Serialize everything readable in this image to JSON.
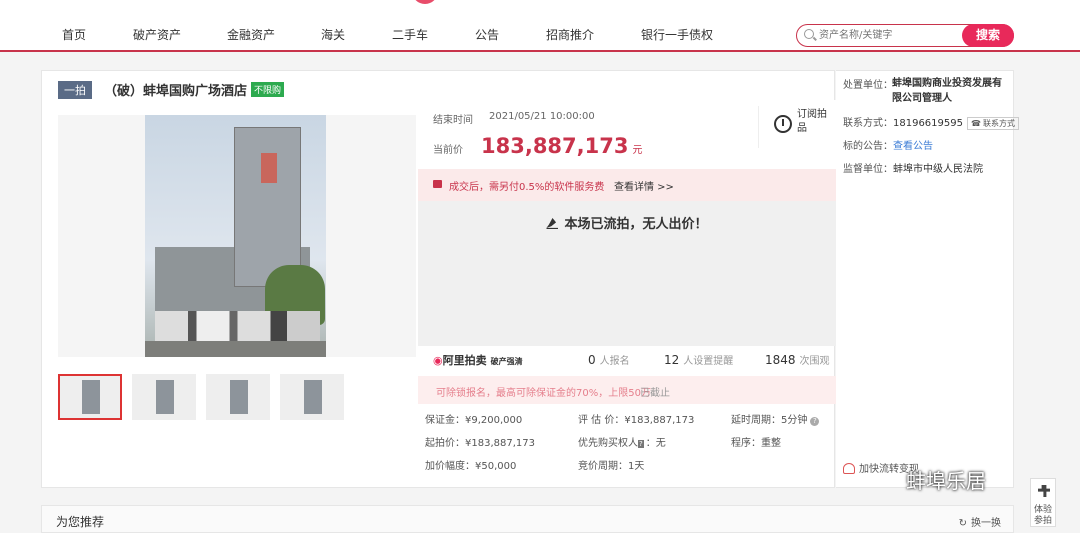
{
  "nav": {
    "items": [
      "首页",
      "破产资产",
      "金融资产",
      "海关",
      "二手车",
      "公告",
      "招商推介",
      "银行一手债权"
    ]
  },
  "search": {
    "placeholder": "资产名称/关键字",
    "button": "搜索"
  },
  "listing": {
    "round_tag": "一拍",
    "title": "（破）蚌埠国购广场酒店",
    "no_limit_tag": "不限购"
  },
  "auction": {
    "end_label": "结束时间",
    "end_value": "2021/05/21 10:00:00",
    "price_label": "当前价",
    "price_value": "183,887,173",
    "price_unit": "元",
    "subscribe_label": "订阅拍品",
    "notice_text": "成交后，需另付0.5%的软件服务费",
    "notice_link": "查看详情 >>",
    "result_text": "本场已流拍，无人出价！"
  },
  "stats": {
    "brand": "阿里拍卖",
    "brand_sub": "破产强清",
    "signup_count": "0",
    "signup_label": "人报名",
    "reminder_count": "12",
    "reminder_label": "人设置提醒",
    "views_count": "1848",
    "views_label": "次围观"
  },
  "deposit_bar": {
    "text": "可除锁报名，最高可除保证金的70%，上限50万",
    "status": "已截止"
  },
  "params": {
    "deposit": "保证金：¥9,200,000",
    "appraisal": "评 估 价：¥183,887,173",
    "delay": "延时周期：5分钟",
    "start_price": "起拍价：¥183,887,173",
    "priority_label": "优先购买权人",
    "priority_value": "：无",
    "procedure": "程序：重整",
    "increment": "加价幅度：¥50,000",
    "period": "竞价周期：1天"
  },
  "side": {
    "org_label": "处置单位：",
    "org_value": "蚌埠国购商业投资发展有限公司管理人",
    "phone_label": "联系方式：",
    "phone_value": "18196619595",
    "phone_tag": "联系方式",
    "notice_label": "标的公告：",
    "notice_link": "查看公告",
    "supervisor_label": "监督单位：",
    "supervisor_value": "蚌埠市中级人民法院",
    "follow_text": "加快流转变现"
  },
  "recommend": {
    "title": "为您推荐",
    "refresh": "换一换"
  },
  "watermark": "蚌埠乐居",
  "float_tab": "体验参拍",
  "colors": {
    "accent": "#c8334b",
    "search_button": "#e8295a",
    "green_tag": "#2daa4f"
  }
}
